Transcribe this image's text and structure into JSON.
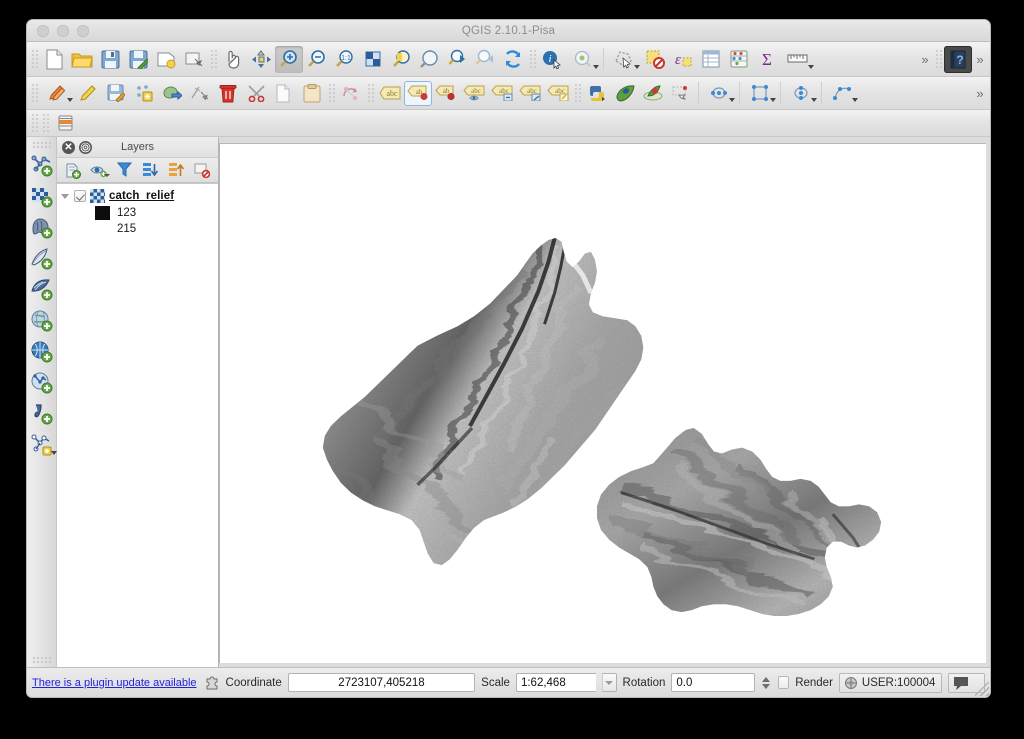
{
  "window": {
    "title": "QGIS 2.10.1-Pisa",
    "traffic_lights": [
      "close-button",
      "minimize-button",
      "zoom-button"
    ]
  },
  "toolbars": {
    "row1": [
      {
        "name": "new-project-button",
        "icon": "new-document-icon",
        "tooltip": "New Project"
      },
      {
        "name": "open-project-button",
        "icon": "open-folder-icon",
        "tooltip": "Open Project"
      },
      {
        "name": "save-project-button",
        "icon": "save-disk-icon",
        "tooltip": "Save Project"
      },
      {
        "name": "save-project-as-button",
        "icon": "save-as-disk-icon",
        "tooltip": "Save Project As"
      },
      {
        "name": "new-print-composer-button",
        "icon": "new-composer-icon",
        "tooltip": "New Print Composer"
      },
      {
        "name": "composer-manager-button",
        "icon": "composer-manager-icon",
        "tooltip": "Composer Manager"
      },
      {
        "name": "pan-map-button",
        "icon": "hand-pan-icon",
        "tooltip": "Pan Map"
      },
      {
        "name": "pan-to-selection-button",
        "icon": "pan-selection-icon",
        "tooltip": "Pan Map to Selection"
      },
      {
        "name": "zoom-in-button",
        "icon": "magnifier-plus-icon",
        "tooltip": "Zoom In",
        "state": "pressed"
      },
      {
        "name": "zoom-out-button",
        "icon": "magnifier-minus-icon",
        "tooltip": "Zoom Out"
      },
      {
        "name": "zoom-full-button",
        "icon": "magnifier-one-to-one-icon",
        "tooltip": "Zoom Full"
      },
      {
        "name": "zoom-native-button",
        "icon": "zoom-native-icon",
        "tooltip": "Zoom to Native Resolution"
      },
      {
        "name": "zoom-to-selection-button",
        "icon": "zoom-selection-icon",
        "tooltip": "Zoom to Selection"
      },
      {
        "name": "zoom-to-layer-button",
        "icon": "zoom-layer-icon",
        "tooltip": "Zoom to Layer"
      },
      {
        "name": "zoom-last-button",
        "icon": "zoom-last-icon",
        "tooltip": "Zoom Last"
      },
      {
        "name": "zoom-next-button",
        "icon": "zoom-next-icon",
        "tooltip": "Zoom Next"
      },
      {
        "name": "refresh-button",
        "icon": "refresh-icon",
        "tooltip": "Refresh"
      },
      {
        "name": "identify-features-button",
        "icon": "identify-info-icon",
        "tooltip": "Identify Features"
      },
      {
        "name": "map-tips-button",
        "icon": "map-tips-icon",
        "tooltip": "Map Tips",
        "has_caret": true
      },
      {
        "name": "select-features-button",
        "icon": "select-features-icon",
        "tooltip": "Select Features",
        "has_caret": true
      },
      {
        "name": "deselect-button",
        "icon": "deselect-icon",
        "tooltip": "Deselect Features"
      },
      {
        "name": "field-calculator-button",
        "icon": "field-calculator-icon",
        "tooltip": "Field Calculator"
      },
      {
        "name": "attribute-table-button",
        "icon": "attribute-table-icon",
        "tooltip": "Open Attribute Table"
      },
      {
        "name": "statistics-button",
        "icon": "abacus-statistics-icon",
        "tooltip": "Statistical Summary"
      },
      {
        "name": "sum-button",
        "icon": "sigma-icon",
        "tooltip": "Sum"
      },
      {
        "name": "measure-button",
        "icon": "ruler-measure-icon",
        "tooltip": "Measure Line",
        "has_caret": true
      },
      {
        "name": "toolbar-overflow-1-button",
        "icon": "chevron-double-right-icon",
        "label": "»"
      },
      {
        "name": "help-button",
        "icon": "question-mark-icon",
        "tooltip": "Help",
        "state": "dark"
      },
      {
        "name": "toolbar-overflow-2-button",
        "icon": "chevron-double-right-icon",
        "label": "»"
      }
    ],
    "row2": [
      {
        "name": "current-edits-button",
        "icon": "pencils-edit-icon",
        "tooltip": "Current Edits",
        "has_caret": true
      },
      {
        "name": "toggle-editing-button",
        "icon": "pencil-icon",
        "tooltip": "Toggle Editing"
      },
      {
        "name": "save-layer-edits-button",
        "icon": "save-edits-icon",
        "tooltip": "Save Layer Edits"
      },
      {
        "name": "add-feature-button",
        "icon": "add-feature-icon",
        "tooltip": "Add Feature"
      },
      {
        "name": "move-feature-button",
        "icon": "move-feature-icon",
        "tooltip": "Move Feature"
      },
      {
        "name": "node-tool-button",
        "icon": "node-tool-icon",
        "tooltip": "Node Tool"
      },
      {
        "name": "delete-selected-button",
        "icon": "trash-icon",
        "tooltip": "Delete Selected"
      },
      {
        "name": "cut-features-button",
        "icon": "scissors-icon",
        "tooltip": "Cut Features"
      },
      {
        "name": "copy-features-button",
        "icon": "copy-page-icon",
        "tooltip": "Copy Features"
      },
      {
        "name": "paste-features-button",
        "icon": "clipboard-paste-icon",
        "tooltip": "Paste Features"
      },
      {
        "name": "undo-redo-button",
        "icon": "rotate-arrows-icon",
        "tooltip": "Undo"
      },
      {
        "name": "label-tool-button",
        "icon": "abc-label-icon",
        "tooltip": "Label Tool"
      },
      {
        "name": "pin-labels-button",
        "icon": "abc-pin-icon",
        "tooltip": "Pin Labels",
        "state": "framed"
      },
      {
        "name": "highlight-labels-button",
        "icon": "abc-highlight-icon",
        "tooltip": "Highlight Pinned Labels"
      },
      {
        "name": "show-hide-labels-button",
        "icon": "abc-eye-icon",
        "tooltip": "Show/Hide Labels"
      },
      {
        "name": "move-label-button",
        "icon": "abc-move-icon",
        "tooltip": "Move Label"
      },
      {
        "name": "rotate-label-button",
        "icon": "abc-rotate-icon",
        "tooltip": "Rotate Label"
      },
      {
        "name": "change-label-button",
        "icon": "abc-change-icon",
        "tooltip": "Change Label"
      },
      {
        "name": "python-console-button",
        "icon": "python-snake-icon",
        "tooltip": "Python Console"
      },
      {
        "name": "plugin-manager-button",
        "icon": "plugin-leaf-icon",
        "tooltip": "Manage and Install Plugins"
      },
      {
        "name": "grass-tools-button",
        "icon": "grass-tools-icon",
        "tooltip": "GRASS Tools"
      },
      {
        "name": "georeferencer-button",
        "icon": "georeferencer-icon",
        "tooltip": "Georeferencer"
      },
      {
        "name": "vertex-circle-button",
        "icon": "circle-vertex-icon",
        "tooltip": "Vertex Tool",
        "has_caret": true
      },
      {
        "name": "rectangle-vertex-button",
        "icon": "rectangle-vertex-icon",
        "tooltip": "Rectangle Tool",
        "has_caret": true
      },
      {
        "name": "ellipse-vertex-button",
        "icon": "ellipse-vertex-icon",
        "tooltip": "Ellipse Tool",
        "has_caret": true
      },
      {
        "name": "curve-vertex-button",
        "icon": "curve-vertex-icon",
        "tooltip": "Curve Tool",
        "has_caret": true
      },
      {
        "name": "toolbar-overflow-3-button",
        "icon": "chevron-double-right-icon",
        "label": "»"
      }
    ],
    "row3": [
      {
        "name": "database-manager-button",
        "icon": "database-icon",
        "tooltip": "DB Manager"
      }
    ]
  },
  "left_toolbar": [
    {
      "name": "add-vector-layer-button",
      "icon": "add-vector-layer-icon",
      "tooltip": "Add Vector Layer"
    },
    {
      "name": "add-raster-layer-button",
      "icon": "add-raster-layer-icon",
      "tooltip": "Add Raster Layer"
    },
    {
      "name": "add-postgis-layer-button",
      "icon": "add-postgis-layer-icon",
      "tooltip": "Add PostGIS Layers"
    },
    {
      "name": "add-spatialite-layer-button",
      "icon": "add-spatialite-layer-icon",
      "tooltip": "Add SpatiaLite Layer"
    },
    {
      "name": "add-mssql-layer-button",
      "icon": "add-mssql-layer-icon",
      "tooltip": "Add MSSQL Spatial Layer"
    },
    {
      "name": "add-wms-layer-button",
      "icon": "add-wms-layer-icon",
      "tooltip": "Add WMS/WMTS Layer"
    },
    {
      "name": "add-wcs-layer-button",
      "icon": "add-wcs-layer-icon",
      "tooltip": "Add WCS Layer"
    },
    {
      "name": "add-wfs-layer-button",
      "icon": "add-wfs-layer-icon",
      "tooltip": "Add WFS Layer"
    },
    {
      "name": "add-delimited-text-layer-button",
      "icon": "add-delimited-text-icon",
      "tooltip": "Add Delimited Text Layer"
    },
    {
      "name": "new-shapefile-layer-button",
      "icon": "new-shapefile-layer-icon",
      "tooltip": "New Shapefile Layer",
      "has_caret": true
    }
  ],
  "layers_panel": {
    "title": "Layers",
    "close_glyph": "✕",
    "float_glyph": "◎",
    "toolbar": [
      {
        "name": "layer-styling-button",
        "icon": "style-manager-icon",
        "tooltip": "Open Layer Styling"
      },
      {
        "name": "manage-visibility-button",
        "icon": "eye-visibility-icon",
        "tooltip": "Manage Layer Visibility",
        "has_caret": true
      },
      {
        "name": "filter-legend-button",
        "icon": "funnel-filter-icon",
        "tooltip": "Filter Legend by Expression"
      },
      {
        "name": "expand-all-button",
        "icon": "expand-all-icon",
        "tooltip": "Expand All"
      },
      {
        "name": "collapse-all-button",
        "icon": "collapse-all-icon",
        "tooltip": "Collapse All"
      },
      {
        "name": "remove-layer-button",
        "icon": "remove-layer-icon",
        "tooltip": "Remove Layer/Group"
      }
    ],
    "tree": [
      {
        "name": "layer-item-catch-relief",
        "label": "catch_relief",
        "type": "raster",
        "checked": true,
        "expanded": true,
        "legend": [
          {
            "swatch": "#0d0d0d",
            "label": "123"
          },
          {
            "swatch": "none",
            "label": "215"
          }
        ]
      }
    ]
  },
  "map": {
    "layer_name": "catch_relief",
    "render_type": "hillshade-relief-raster",
    "background": "#ffffff"
  },
  "statusbar": {
    "plugin_update_text": "There is a plugin update available",
    "plugin_update_icon": "plugin-puzzle-icon",
    "coordinate_label": "Coordinate",
    "coordinate_value": "2723107,405218",
    "scale_label": "Scale",
    "scale_value": "1:62,468",
    "scale_dropdown_icon": "chevron-down-icon",
    "rotation_label": "Rotation",
    "rotation_value": "0.0",
    "render_label": "Render",
    "render_checked": false,
    "crs_icon": "crs-globe-icon",
    "crs_value": "USER:100004",
    "messages_icon": "speech-bubble-icon"
  }
}
